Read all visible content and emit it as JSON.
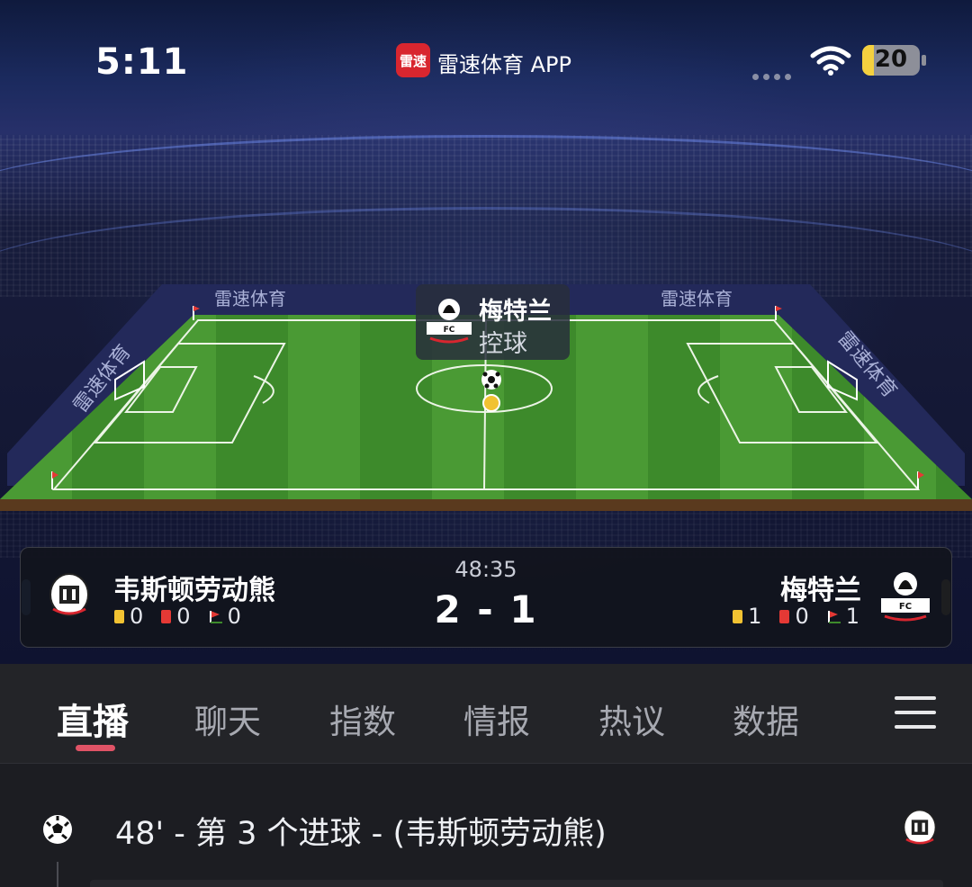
{
  "status_bar": {
    "time": "5:11",
    "app_badge": "雷速",
    "app_name": "雷速体育 APP",
    "battery": "20",
    "battery_level": 0.2
  },
  "pitch": {
    "watermark": "雷速体育",
    "possession_team": "梅特兰",
    "possession_label": "控球"
  },
  "match": {
    "time": "48:35",
    "score": "2 - 1",
    "home": {
      "name": "韦斯顿劳动熊",
      "color": "#6cb6f0",
      "yellow": "0",
      "red": "0",
      "corners": "0"
    },
    "away": {
      "name": "梅特兰",
      "color": "#ead04a",
      "yellow": "1",
      "red": "0",
      "corners": "1"
    }
  },
  "tabs": [
    {
      "label": "直播",
      "active": true
    },
    {
      "label": "聊天"
    },
    {
      "label": "指数"
    },
    {
      "label": "情报"
    },
    {
      "label": "热议"
    },
    {
      "label": "数据"
    }
  ],
  "feed": {
    "events": [
      {
        "text": "48' - 第 3 个进球 - (韦斯顿劳动熊)",
        "icon": "soccer-ball-icon"
      }
    ]
  }
}
